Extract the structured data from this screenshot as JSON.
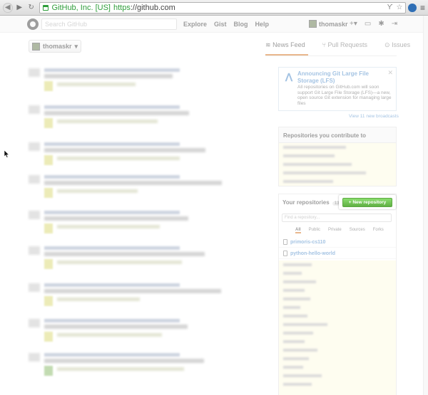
{
  "browser": {
    "site_identity": "GitHub, Inc. [US]",
    "url_scheme": "https",
    "url_rest": "://github.com"
  },
  "header": {
    "search_placeholder": "Search GitHub",
    "nav": [
      "Explore",
      "Gist",
      "Blog",
      "Help"
    ],
    "username": "thomaskr",
    "plus_label": "+▾"
  },
  "context": {
    "switcher_label": "thomaskr"
  },
  "tabs": [
    "News Feed",
    "Pull Requests",
    "Issues"
  ],
  "announcement": {
    "title": "Announcing Git Large File Storage (LFS)",
    "body": "All repositories on GitHub.com will soon support Git Large File Storage (LFS)—a new, open source Git extension for managing large files",
    "more_link": "View 11 new broadcasts"
  },
  "contribute_box": {
    "title": "Repositories you contribute to"
  },
  "your_repos": {
    "title": "Your repositories",
    "count": "13",
    "new_button": "+ New repository",
    "filter_placeholder": "Find a repository...",
    "filters": [
      "All",
      "Public",
      "Private",
      "Sources",
      "Forks"
    ],
    "repos": [
      "primoris-cs110",
      "python-hello-world"
    ]
  },
  "colors": {
    "new_button_green": "#6cc644",
    "link_blue": "#4183c4",
    "tab_accent": "#d26911",
    "repo_list_tint": "#fdfae0"
  }
}
